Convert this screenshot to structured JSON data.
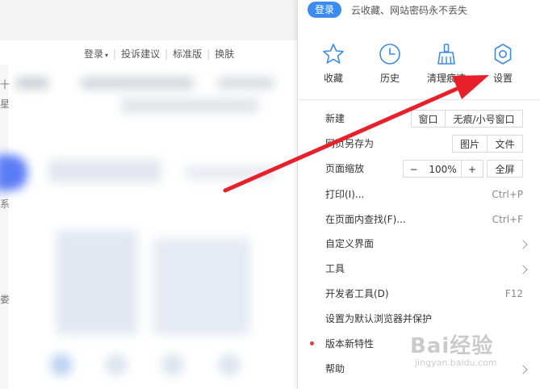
{
  "background": {
    "toplinks": {
      "login": "登录",
      "feedback": "投诉建议",
      "standard": "标准版",
      "skin": "换肤"
    },
    "side_chars": [
      "十",
      "星",
      "系",
      "娄"
    ]
  },
  "menu": {
    "login_button": "登录",
    "login_tip": "云收藏、网站密码永不丢失",
    "tools": [
      {
        "label": "收藏",
        "icon": "star-icon"
      },
      {
        "label": "历史",
        "icon": "clock-icon"
      },
      {
        "label": "清理痕迹",
        "icon": "broom-icon"
      },
      {
        "label": "设置",
        "icon": "gear-icon"
      }
    ],
    "new": {
      "label": "新建",
      "window": "窗口",
      "private_window": "无痕/小号窗口"
    },
    "save_as": {
      "label": "网页另存为",
      "image": "图片",
      "file": "文件"
    },
    "zoom": {
      "label": "页面缩放",
      "minus": "−",
      "value": "100%",
      "plus": "+",
      "fullscreen": "全屏"
    },
    "print": {
      "label": "打印(I)...",
      "shortcut": "Ctrl+P"
    },
    "find": {
      "label": "在页面内查找(F)...",
      "shortcut": "Ctrl+F"
    },
    "customize": {
      "label": "自定义界面"
    },
    "tools_menu": {
      "label": "工具"
    },
    "devtools": {
      "label": "开发者工具(D)",
      "shortcut": "F12"
    },
    "default_browser": {
      "label": "设置为默认浏览器并保护"
    },
    "whats_new": {
      "label": "版本新特性"
    },
    "help": {
      "label": "帮助"
    }
  },
  "watermark": {
    "brand": "Bai经验",
    "url": "jingyan.baidu.com"
  },
  "colors": {
    "accent": "#3b8cf0",
    "icon_blue": "#3a8be6",
    "arrow": "#e8202a",
    "new_dot": "#e04040"
  }
}
